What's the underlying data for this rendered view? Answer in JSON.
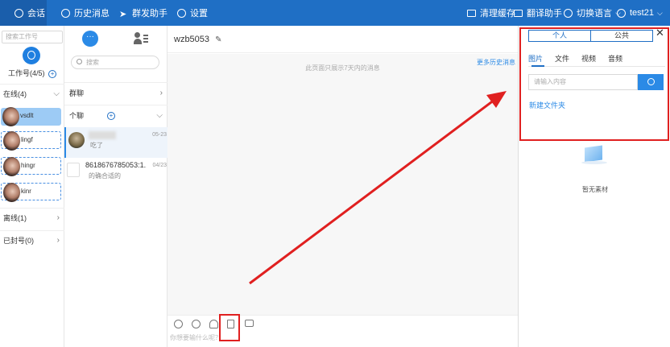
{
  "topbar": {
    "nav": [
      {
        "label": "会话",
        "icon": "chat-bubble-icon",
        "active": true
      },
      {
        "label": "历史消息",
        "icon": "clock-icon",
        "active": false
      },
      {
        "label": "群发助手",
        "icon": "send-icon",
        "active": false
      },
      {
        "label": "设置",
        "icon": "gear-icon",
        "active": false
      }
    ],
    "right": [
      {
        "label": "清理缓存",
        "icon": "monitor-icon"
      },
      {
        "label": "翻译助手",
        "icon": "translate-icon"
      },
      {
        "label": "切换语言",
        "icon": "globe-icon"
      },
      {
        "label": "test21",
        "icon": "user-icon"
      }
    ]
  },
  "accounts": {
    "search_placeholder": "搜索工作号",
    "title": "工作号(4/5)",
    "online_label": "在线(4)",
    "items": [
      "vsdlt",
      "lingf",
      "hingr",
      "kinr"
    ],
    "offline_label": "离线(1)",
    "banned_label": "已封号(0)"
  },
  "chats": {
    "search_placeholder": "搜索",
    "group_label": "群聊",
    "private_label": "个聊",
    "items": [
      {
        "name": "",
        "msg": "吃了",
        "date": "05-23"
      },
      {
        "name": "8618676785053:1...",
        "msg": "的确合适的",
        "date": "04/23"
      }
    ]
  },
  "conversation": {
    "title": "wzb5053",
    "hint": "此页面只展示7天内的消息",
    "history_link": "更多历史消息",
    "input_placeholder": "你想要输什么呢？"
  },
  "materials": {
    "segments": [
      "个人",
      "公共"
    ],
    "tabs": [
      "图片",
      "文件",
      "视频",
      "音频"
    ],
    "search_placeholder": "请输入内容",
    "new_folder": "新建文件夹",
    "empty_text": "暂无素材"
  },
  "colors": {
    "brand": "#1f6fc5",
    "highlight": "#e02020"
  }
}
